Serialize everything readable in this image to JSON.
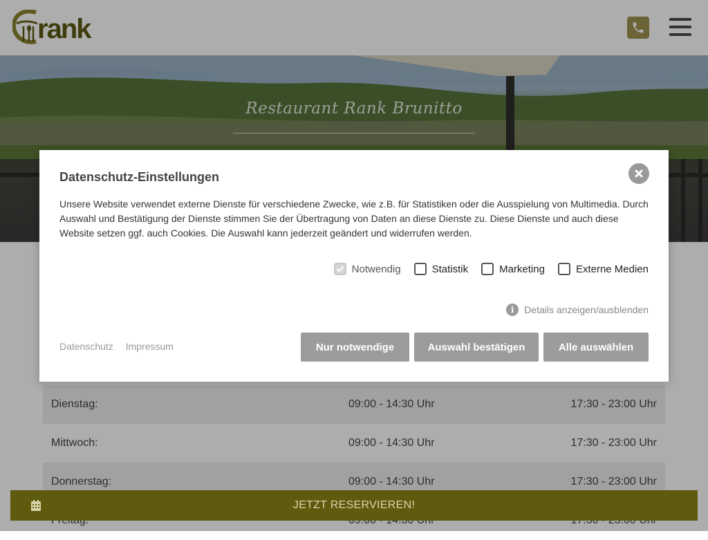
{
  "header": {
    "logo_text": "rank",
    "phone_icon": "phone-icon",
    "menu_icon": "hamburger-menu-icon"
  },
  "hero": {
    "title": "Restaurant Rank Brunitto"
  },
  "hours": {
    "rows": [
      {
        "day": "Dienstag:",
        "lunch": "09:00 - 14:30 Uhr",
        "dinner": "17:30 - 23:00 Uhr"
      },
      {
        "day": "Mittwoch:",
        "lunch": "09:00 - 14:30 Uhr",
        "dinner": "17:30 - 23:00 Uhr"
      },
      {
        "day": "Donnerstag:",
        "lunch": "09:00 - 14:30 Uhr",
        "dinner": "17:30 - 23:00 Uhr"
      },
      {
        "day": "Freitag:",
        "lunch": "09:00 - 14:30 Uhr",
        "dinner": "17:30 - 23:00 Uhr"
      }
    ]
  },
  "privacy_modal": {
    "title": "Datenschutz-Einstellungen",
    "text": "Unsere Website verwendet externe Dienste für verschiedene Zwecke, wie z.B. für Statistiken oder die Ausspielung von Multimedia. Durch Auswahl und Bestätigung der Dienste stimmen Sie der Übertragung von Daten an diese Dienste zu. Diese Dienste und auch diese Website setzen ggf. auch Cookies. Die Auswahl kann jederzeit geändert und widerrufen werden.",
    "options": [
      {
        "label": "Notwendig",
        "checked": true,
        "disabled": true
      },
      {
        "label": "Statistik",
        "checked": false,
        "disabled": false
      },
      {
        "label": "Marketing",
        "checked": false,
        "disabled": false
      },
      {
        "label": "Externe Medien",
        "checked": false,
        "disabled": false
      }
    ],
    "details_label": "Details anzeigen/ausblenden",
    "links": {
      "privacy": "Datenschutz",
      "imprint": "Impressum"
    },
    "buttons": {
      "necessary_only": "Nur notwendige",
      "confirm_selection": "Auswahl bestätigen",
      "select_all": "Alle auswählen"
    },
    "close_icon": "close-icon"
  },
  "reservation": {
    "label": "JETZT RESERVIEREN!",
    "icon": "calendar-icon"
  },
  "colors": {
    "brand_olive": "#5e5a0e",
    "phone_gold": "#a09250",
    "button_gray": "#9c9c9c"
  }
}
